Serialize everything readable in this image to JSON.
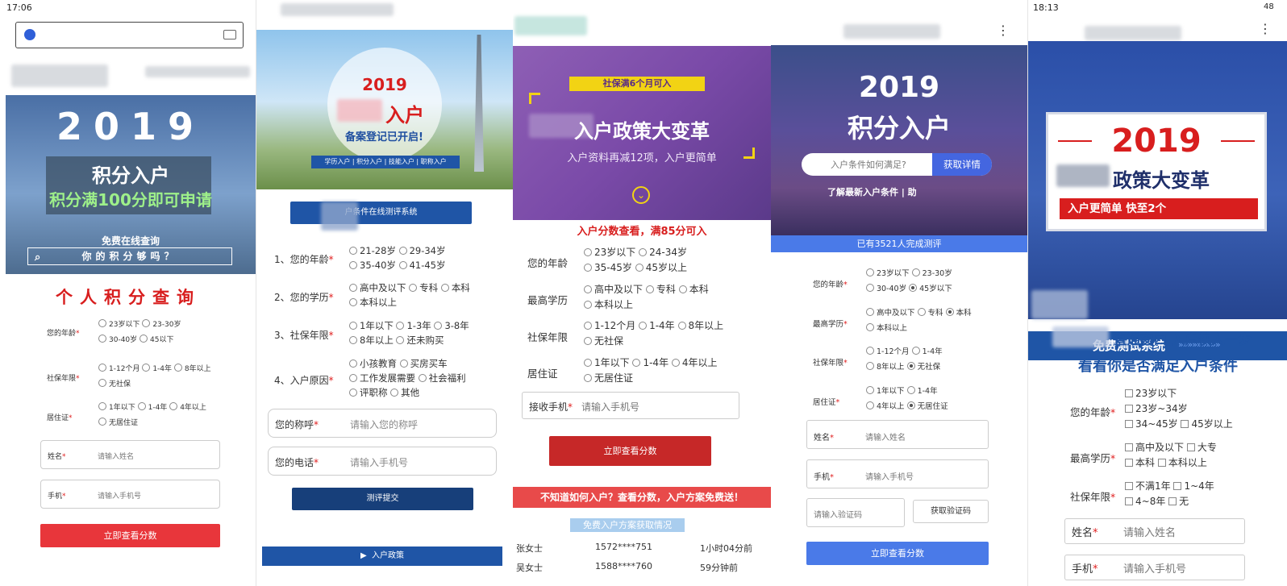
{
  "status": {
    "time_left": "17:06",
    "time_right": "18:13",
    "battery": "48"
  },
  "p1": {
    "year": "2019",
    "title": "积分入户",
    "subtitle": "积分满100分即可申请",
    "free_label": "免费在线查询",
    "search_text": "你的积分够吗？",
    "query_title": "个人积分查询",
    "rows": [
      {
        "label": "您的年龄",
        "opts": [
          "23岁以下",
          "23-30岁",
          "30-40岁",
          "45以下"
        ]
      },
      {
        "label": "社保年限",
        "opts": [
          "1-12个月",
          "1-4年",
          "8年以上",
          "无社保"
        ]
      },
      {
        "label": "居住证",
        "opts": [
          "1年以下",
          "1-4年",
          "4年以上",
          "无居住证"
        ]
      }
    ],
    "name_label": "姓名",
    "name_ph": "请输入姓名",
    "phone_label": "手机",
    "phone_ph": "请输入手机号",
    "button": "立即查看分数"
  },
  "p2": {
    "year": "2019",
    "title_tail": "入户",
    "register": "备案登记已开启!",
    "tags": "学历入户 | 积分入户 | 技能入户 | 职称入户",
    "eval_button": "户条件在线测评系统",
    "questions": [
      {
        "label": "1、您的年龄",
        "opts": [
          "21-28岁",
          "29-34岁",
          "35-40岁",
          "41-45岁"
        ]
      },
      {
        "label": "2、您的学历",
        "opts": [
          "高中及以下",
          "专科",
          "本科",
          "本科以上"
        ]
      },
      {
        "label": "3、社保年限",
        "opts": [
          "1年以下",
          "1-3年",
          "3-8年",
          "8年以上",
          "还未购买"
        ]
      },
      {
        "label": "4、入户原因",
        "opts": [
          "小孩教育",
          "买房买车",
          "工作发展需要",
          "社会福利",
          "评职称",
          "其他"
        ]
      }
    ],
    "name_label": "您的称呼",
    "name_ph": "请输入您的称呼",
    "phone_label": "您的电话",
    "phone_ph": "请输入手机号",
    "submit": "测评提交",
    "bottom": "入户政策"
  },
  "p3": {
    "tag": "社保满6个月可入",
    "title": "入户政策大变革",
    "subtitle": "入户资料再减12项，入户更简单",
    "head": "入户分数查看，满85分可入",
    "questions": [
      {
        "label": "您的年龄",
        "opts": [
          "23岁以下",
          "24-34岁",
          "35-45岁",
          "45岁以上"
        ]
      },
      {
        "label": "最高学历",
        "opts": [
          "高中及以下",
          "专科",
          "本科",
          "本科以上"
        ]
      },
      {
        "label": "社保年限",
        "opts": [
          "1-12个月",
          "1-4年",
          "8年以上",
          "无社保"
        ]
      },
      {
        "label": "居住证",
        "opts": [
          "1年以下",
          "1-4年",
          "4年以上",
          "无居住证"
        ]
      }
    ],
    "phone_label": "接收手机",
    "phone_ph": "请输入手机号",
    "button": "立即查看分数",
    "red_bar": "不知道如何入户？查看分数，入户方案免费送！",
    "blue_tag": "免费入户方案获取情况",
    "records": [
      {
        "name": "张女士",
        "phone": "1572****751",
        "time": "1小时04分前"
      },
      {
        "name": "吴女士",
        "phone": "1588****760",
        "time": "59分钟前"
      }
    ]
  },
  "p4": {
    "year": "2019",
    "title": "积分入户",
    "search_ph": "入户条件如何满足?",
    "search_btn": "获取详情",
    "learn": "了解最新入户条件 | 助",
    "count": "已有3521人完成测评",
    "questions": [
      {
        "label": "您的年龄",
        "opts": [
          "23岁以下",
          "23-30岁",
          "30-40岁",
          "45岁以下"
        ]
      },
      {
        "label": "最高学历",
        "opts": [
          "高中及以下",
          "专科",
          "本科",
          "本科以上"
        ]
      },
      {
        "label": "社保年限",
        "opts": [
          "1-12个月",
          "1-4年",
          "8年以上",
          "无社保"
        ]
      },
      {
        "label": "居住证",
        "opts": [
          "1年以下",
          "1-4年",
          "4年以上",
          "无居住证"
        ]
      }
    ],
    "name_label": "姓名",
    "name_ph": "请输入姓名",
    "phone_label": "手机",
    "phone_ph": "请输入手机号",
    "code_ph": "请输入验证码",
    "code_btn": "获取验证码",
    "button": "立即查看分数"
  },
  "p5": {
    "year": "2019",
    "title": "政策大变革",
    "red_bar": "入户更简单  快至2个",
    "bar_text": "免费测试系统",
    "bar_arrows": "»»»»»»»»»",
    "line3": "直通窗口 入户快人一步",
    "line4": "看看你是否满足入户条件",
    "questions": [
      {
        "label": "您的年龄",
        "opts": [
          "23岁以下",
          "23岁~34岁",
          "34~45岁",
          "45岁以上"
        ]
      },
      {
        "label": "最高学历",
        "opts": [
          "高中及以下",
          "大专",
          "本科",
          "本科以上"
        ]
      },
      {
        "label": "社保年限",
        "opts": [
          "不满1年",
          "1~4年",
          "4~8年",
          "无"
        ]
      }
    ],
    "name_label": "姓名",
    "name_ph": "请输入姓名",
    "phone_label": "手机",
    "phone_ph": "请输入手机号"
  }
}
